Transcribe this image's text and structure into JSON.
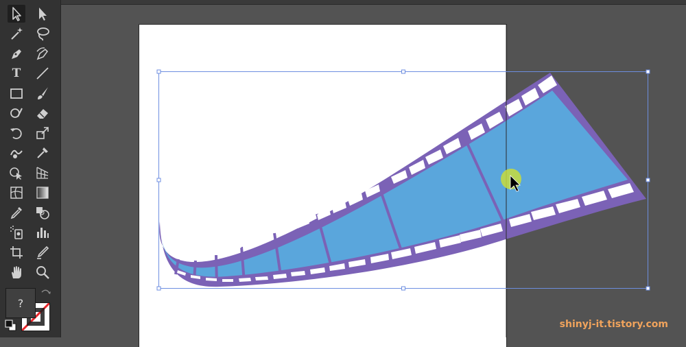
{
  "app": "Adobe Illustrator",
  "toolbar": {
    "type_tool_glyph": "T",
    "tools": [
      {
        "id": "selection",
        "icon": "selection-arrow-icon",
        "active": true
      },
      {
        "id": "direct-selection",
        "icon": "direct-selection-arrow-icon"
      },
      {
        "id": "magic-wand",
        "icon": "magic-wand-icon"
      },
      {
        "id": "lasso",
        "icon": "lasso-icon"
      },
      {
        "id": "pen",
        "icon": "pen-icon"
      },
      {
        "id": "curvature",
        "icon": "curvature-pen-icon"
      },
      {
        "id": "type",
        "icon": "type-icon"
      },
      {
        "id": "line-segment",
        "icon": "line-segment-icon"
      },
      {
        "id": "rectangle",
        "icon": "rectangle-icon"
      },
      {
        "id": "paintbrush",
        "icon": "paintbrush-icon"
      },
      {
        "id": "shaper",
        "icon": "shaper-icon"
      },
      {
        "id": "eraser",
        "icon": "eraser-icon"
      },
      {
        "id": "rotate",
        "icon": "rotate-icon"
      },
      {
        "id": "scale",
        "icon": "scale-icon"
      },
      {
        "id": "warp",
        "icon": "warp-icon"
      },
      {
        "id": "puppet-warp",
        "icon": "puppet-warp-icon"
      },
      {
        "id": "shape-builder",
        "icon": "shape-builder-icon"
      },
      {
        "id": "perspective-grid",
        "icon": "perspective-grid-icon"
      },
      {
        "id": "mesh",
        "icon": "mesh-icon"
      },
      {
        "id": "gradient",
        "icon": "gradient-icon"
      },
      {
        "id": "eyedropper",
        "icon": "eyedropper-icon"
      },
      {
        "id": "blend",
        "icon": "blend-icon"
      },
      {
        "id": "symbol-sprayer",
        "icon": "symbol-sprayer-icon"
      },
      {
        "id": "column-graph",
        "icon": "column-graph-icon"
      },
      {
        "id": "artboard",
        "icon": "artboard-icon"
      },
      {
        "id": "slice",
        "icon": "slice-icon"
      },
      {
        "id": "hand",
        "icon": "hand-icon"
      },
      {
        "id": "zoom",
        "icon": "zoom-icon"
      }
    ],
    "fill_swatch_label": "?",
    "stroke_swatch": "none",
    "colors": {
      "panel": "#323232",
      "icon": "#cfcfcf",
      "active": "#1f1f1f"
    }
  },
  "canvas": {
    "pasteboard_color": "#535353",
    "artboard_color": "#ffffff",
    "selection_color": "#6d8ee0",
    "filmstrip": {
      "frame_fill": "#5aa6dc",
      "border": "#7b62b6",
      "sprocket_hole": "#ffffff",
      "frame_count": 9
    },
    "cursor_highlight": "#c8dc3c"
  },
  "watermark": "shinyj-it.tistory.com"
}
